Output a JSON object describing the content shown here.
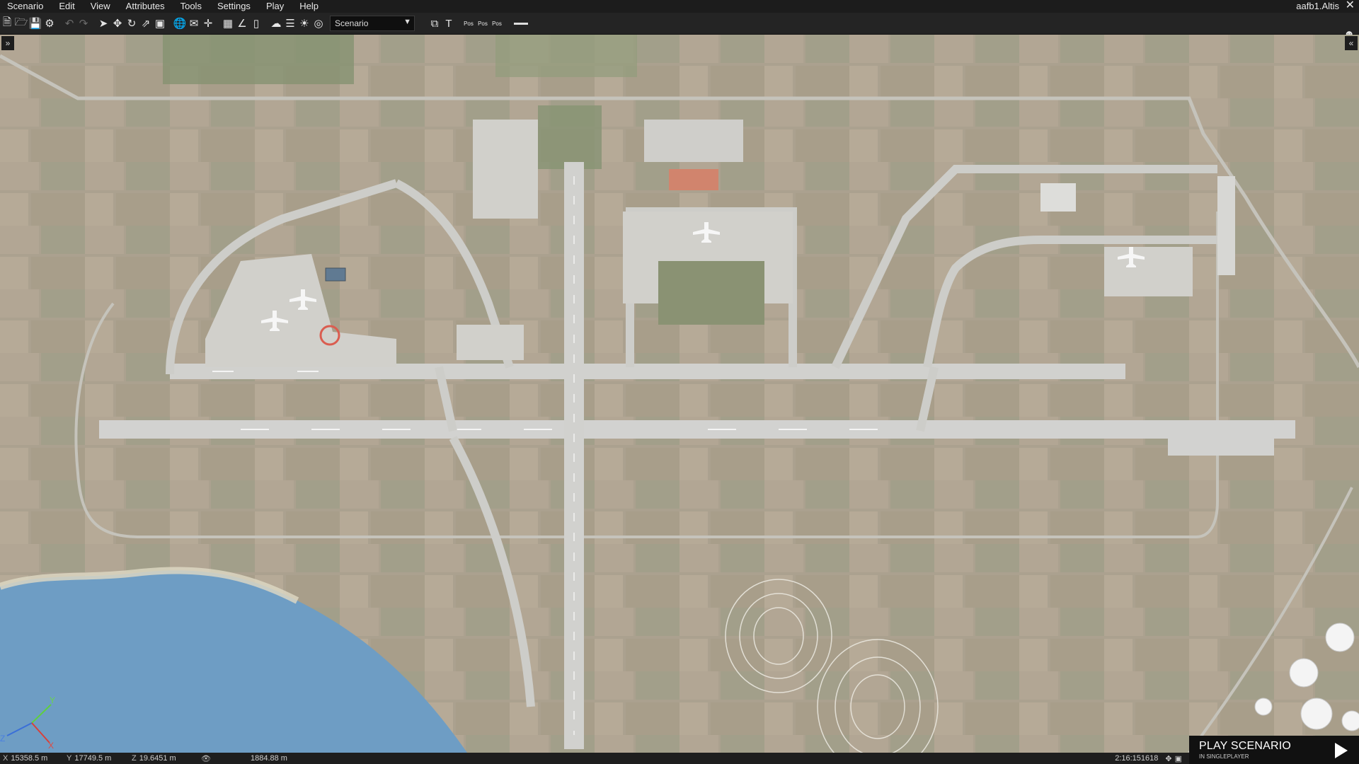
{
  "menu": {
    "items": [
      "Scenario",
      "Edit",
      "View",
      "Attributes",
      "Tools",
      "Settings",
      "Play",
      "Help"
    ],
    "world_name": "aafb1.Altis"
  },
  "toolbar": {
    "mode_select": "Scenario",
    "icons": [
      "new-icon",
      "open-icon",
      "save-icon",
      "steam-icon",
      "undo-icon",
      "redo-icon",
      "select-icon",
      "move-icon",
      "rotate-icon",
      "scale-icon",
      "area-icon",
      "globe-icon",
      "surface-icon",
      "vertical-icon",
      "grid-icon",
      "angle-icon",
      "bar-icon",
      "weather-icon",
      "poles-icon",
      "time-icon",
      "binoculars-icon",
      "screenshot-icon",
      "text-icon",
      "pos1-icon",
      "pos2-icon",
      "pos3-icon",
      "minimize-icon",
      "user-icon"
    ],
    "pos_labels": [
      "Pos",
      "Pos",
      "Pos"
    ]
  },
  "map": {
    "background": "#8f8670",
    "water_color": "#4f88b8",
    "runway_color": "#c7c7c4",
    "description_free": true
  },
  "status": {
    "x_label": "X",
    "x_value": "15358.5 m",
    "y_label": "Y",
    "y_value": "17749.5 m",
    "z_label": "Z",
    "z_value": "19.6451 m",
    "view_distance": "1884.88 m",
    "time": "2:16:151618"
  },
  "play": {
    "title": "PLAY SCENARIO",
    "subtitle": "IN SINGLEPLAYER"
  },
  "axis": {
    "x": "X",
    "y": "Y",
    "z": "Z"
  },
  "toggles": {
    "left": "»",
    "right": "«"
  }
}
